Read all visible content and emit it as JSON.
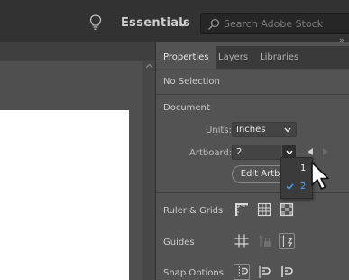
{
  "topbar": {
    "workspace_label": "Essentials",
    "stock_search_placeholder": "Search Adobe Stock",
    "collapse_glyph": "»"
  },
  "panel": {
    "tabs": [
      {
        "label": "Properties",
        "active": true
      },
      {
        "label": "Layers",
        "active": false
      },
      {
        "label": "Libraries",
        "active": false
      }
    ],
    "selection_status": "No Selection",
    "document_section": {
      "title": "Document",
      "units_label": "Units:",
      "units_value": "Inches",
      "artboard_label": "Artboard:",
      "artboard_value": "2",
      "artboard_dropdown_options": [
        {
          "label": "1",
          "checked": false
        },
        {
          "label": "2",
          "checked": true
        }
      ],
      "edit_button_label": "Edit Artboards"
    },
    "ruler_grids_label": "Ruler & Grids",
    "guides_label": "Guides",
    "snap_options_label": "Snap Options"
  },
  "colors": {
    "app_bar": "#323232",
    "panel_bg": "#535353",
    "accent_blue": "#4aa3ff",
    "artboard": "#ffffff"
  },
  "icons": [
    "lightbulb-icon",
    "chevron-down-icon",
    "search-icon",
    "rulers-icon",
    "grid-icon",
    "transparency-grid-icon",
    "show-guides-icon",
    "lock-guides-icon",
    "smart-guides-icon",
    "snap-to-point-icon",
    "snap-to-pixel-icon",
    "snap-to-glyph-icon",
    "mouse-pointer-icon"
  ]
}
